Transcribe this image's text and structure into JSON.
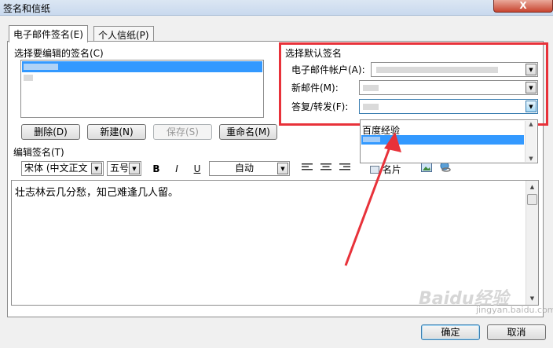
{
  "window": {
    "title": "签名和信纸",
    "close_glyph": "X"
  },
  "tabs": [
    {
      "label": "电子邮件签名(E)"
    },
    {
      "label": "个人信纸(P)"
    }
  ],
  "signature_list": {
    "label": "选择要编辑的签名(C)"
  },
  "buttons": {
    "delete": "删除(D)",
    "new": "新建(N)",
    "save": "保存(S)",
    "rename": "重命名(M)",
    "ok": "确定",
    "cancel": "取消"
  },
  "default_signature": {
    "group_label": "选择默认签名",
    "account_label": "电子邮件帐户(A):",
    "new_messages_label": "新邮件(M):",
    "replies_label": "答复/转发(F):",
    "dropdown_items": [
      "百度经验"
    ]
  },
  "editor": {
    "label": "编辑签名(T)",
    "font_name": "宋体 (中文正文",
    "font_size": "五号",
    "color": "自动",
    "bold_glyph": "B",
    "italic_glyph": "I",
    "underline_glyph": "U",
    "business_card_label": "名片",
    "text": "壮志林云几分愁，知己难逢几人留。"
  },
  "annotation": {
    "highlight_color": "#e8323a"
  },
  "watermark": {
    "text": "Baidu经验",
    "sub": "jingyan.baidu.com"
  }
}
